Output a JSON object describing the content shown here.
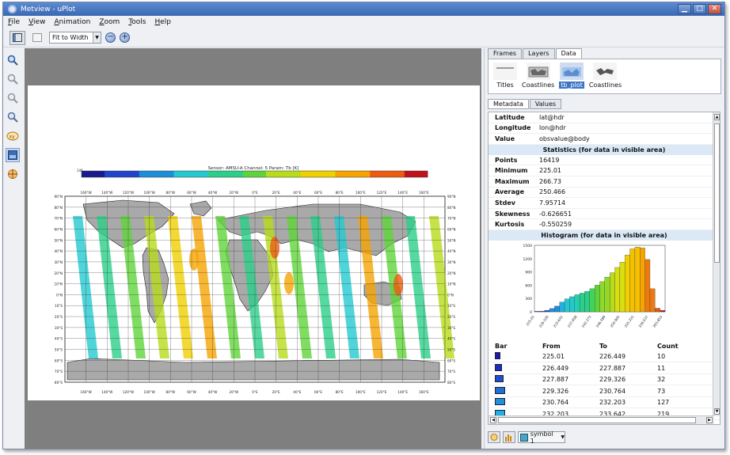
{
  "window": {
    "title": "Metview - uPlot"
  },
  "menu": [
    "File",
    "View",
    "Animation",
    "Zoom",
    "Tools",
    "Help"
  ],
  "toolbar": {
    "zoom_mode": "Fit to Width"
  },
  "plot": {
    "title": "Sensor: AMSU-A Channel: 5 Param: Tb [K]",
    "colorbar_label": "146",
    "lon_labels": [
      "160°W",
      "140°W",
      "120°W",
      "100°W",
      "80°W",
      "60°W",
      "40°W",
      "20°W",
      "0°E",
      "20°E",
      "40°E",
      "60°E",
      "80°E",
      "100°E",
      "120°E",
      "140°E",
      "160°E"
    ],
    "lat_labels": [
      "90°N",
      "80°N",
      "70°N",
      "60°N",
      "50°N",
      "40°N",
      "30°N",
      "20°N",
      "10°N",
      "0°N",
      "10°S",
      "20°S",
      "30°S",
      "40°S",
      "50°S",
      "60°S",
      "70°S",
      "80°S"
    ],
    "colors": [
      "#1a1a8c",
      "#2244cc",
      "#1c8fd8",
      "#23c9d0",
      "#2ad08a",
      "#5fd43a",
      "#b6dc1a",
      "#f0d000",
      "#f5a400",
      "#ec5b10",
      "#c0121a"
    ]
  },
  "tabs": {
    "main": [
      "Frames",
      "Layers",
      "Data"
    ],
    "active": "Data",
    "sub": [
      "Metadata",
      "Values"
    ],
    "sub_active": "Metadata"
  },
  "layers": [
    {
      "label": "Titles"
    },
    {
      "label": "Coastlines"
    },
    {
      "label": "tb_plot"
    },
    {
      "label": "Coastlines"
    }
  ],
  "meta": [
    {
      "k": "Latitude",
      "v": "lat@hdr"
    },
    {
      "k": "Longitude",
      "v": "lon@hdr"
    },
    {
      "k": "Value",
      "v": "obsvalue@body"
    }
  ],
  "stats_header": "Statistics (for data in visible area)",
  "stats": [
    {
      "k": "Points",
      "v": "16419"
    },
    {
      "k": "Minimum",
      "v": "225.01"
    },
    {
      "k": "Maximum",
      "v": "266.73"
    },
    {
      "k": "Average",
      "v": "250.466"
    },
    {
      "k": "Stdev",
      "v": "7.95714"
    },
    {
      "k": "Skewness",
      "v": "-0.626651"
    },
    {
      "k": "Kurtosis",
      "v": "-0.550259"
    }
  ],
  "hist_header": "Histogram (for data in visible area)",
  "chart_data": {
    "type": "bar",
    "yticks": [
      0,
      300,
      600,
      900,
      1200,
      1500
    ],
    "ylim": [
      0,
      1500
    ],
    "xticklabels": [
      "225.01",
      "229.326",
      "233.642",
      "237.958",
      "242.273",
      "246.589",
      "250.905",
      "255.221",
      "259.537",
      "263.853"
    ],
    "values": [
      10,
      11,
      32,
      73,
      127,
      219,
      290,
      340,
      385,
      420,
      460,
      520,
      600,
      680,
      780,
      880,
      1000,
      1120,
      1280,
      1420,
      1460,
      1440,
      1180,
      520,
      80,
      30
    ]
  },
  "table": {
    "headers": [
      "Bar",
      "From",
      "To",
      "Count"
    ],
    "rows": [
      {
        "from": "225.01",
        "to": "226.449",
        "count": "10",
        "color": "#1a1ab4"
      },
      {
        "from": "226.449",
        "to": "227.887",
        "count": "11",
        "color": "#1a2ec0"
      },
      {
        "from": "227.887",
        "to": "229.326",
        "count": "32",
        "color": "#1c50cc"
      },
      {
        "from": "229.326",
        "to": "230.764",
        "count": "73",
        "color": "#1f70d4"
      },
      {
        "from": "230.764",
        "to": "232.203",
        "count": "127",
        "color": "#1e90dc"
      },
      {
        "from": "232.203",
        "to": "233.642",
        "count": "219",
        "color": "#22b0e2"
      }
    ]
  },
  "bottom": {
    "symbol": "symbol 1"
  }
}
